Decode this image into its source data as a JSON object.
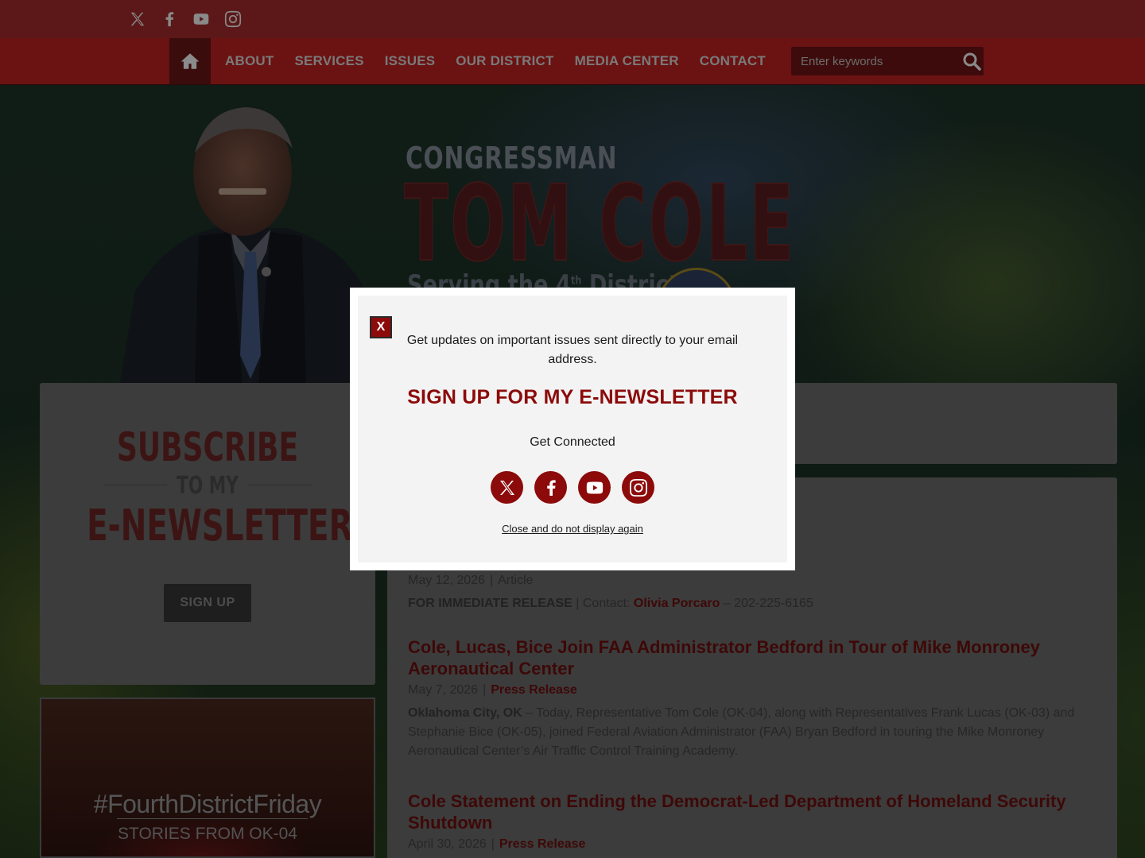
{
  "top_social": {
    "icons": [
      "x-icon",
      "facebook-icon",
      "youtube-icon",
      "instagram-icon"
    ]
  },
  "nav": {
    "home_icon": "home-icon",
    "items": [
      {
        "label": "ABOUT"
      },
      {
        "label": "SERVICES"
      },
      {
        "label": "ISSUES"
      },
      {
        "label": "OUR DISTRICT"
      },
      {
        "label": "MEDIA CENTER"
      },
      {
        "label": "CONTACT"
      }
    ],
    "search": {
      "placeholder": "Enter keywords",
      "value": ""
    }
  },
  "hero": {
    "kicker": "CONGRESSMAN",
    "name": "TOM COLE",
    "serving_prefix": "Serving the 4",
    "serving_sup": "th",
    "serving_suffix": " District of"
  },
  "subscribe_card": {
    "line1": "SUBSCRIBE",
    "line2": "TO MY",
    "line3": "E-NEWSLETTER",
    "button_label": "SIGN UP"
  },
  "fdf_card": {
    "title": "#FourthDistrictFriday",
    "subtitle": "STORIES FROM OK-04"
  },
  "news": {
    "items": [
      {
        "date": "May 12, 2026",
        "type": "Article",
        "body_lead": "FOR IMMEDIATE RELEASE",
        "body_contact_label": " | Contact: ",
        "body_contact_name": "Olivia Porcaro",
        "body_contact_phone": " – 202-225-6165"
      },
      {
        "title": "Cole, Lucas, Bice Join FAA Administrator Bedford in Tour of Mike Monroney Aeronautical Center",
        "date": "May 7, 2026",
        "type": "Press Release",
        "body_lead": "Oklahoma City, OK",
        "body_text": " – Today, Representative Tom Cole (OK-04), along with Representatives Frank Lucas (OK-03) and Stephanie Bice (OK-05), joined Federal Aviation Administrator (FAA) Bryan Bedford in touring the Mike Monroney Aeronautical Center’s Air Traffic Control Training Academy."
      },
      {
        "title": "Cole Statement on Ending the Democrat-Led Department of Homeland Security Shutdown",
        "date": "April 30, 2026",
        "type": "Press Release"
      }
    ]
  },
  "modal": {
    "close_label": "X",
    "intro": "Get updates on important issues sent directly to your email address.",
    "title": "SIGN UP FOR MY E-NEWSLETTER",
    "connected": "Get Connected",
    "social_icons": [
      "x-icon",
      "facebook-icon",
      "youtube-icon",
      "instagram-icon"
    ],
    "dismiss": "Close and do not display again"
  },
  "colors": {
    "brand_red": "#8c0a0a",
    "modal_bg": "#f3f3f3"
  }
}
